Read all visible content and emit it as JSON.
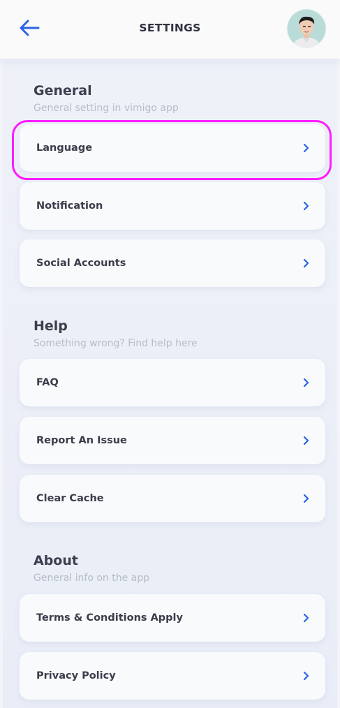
{
  "header": {
    "title": "SETTINGS",
    "accent_color": "#2a63e6"
  },
  "sections": [
    {
      "title": "General",
      "subtitle": "General setting in vimigo app",
      "items": [
        {
          "label": "Language",
          "icon": "chevron-right-icon"
        },
        {
          "label": "Notification",
          "icon": "chevron-right-icon"
        },
        {
          "label": "Social Accounts",
          "icon": "chevron-right-icon"
        }
      ]
    },
    {
      "title": "Help",
      "subtitle": "Something wrong? Find help here",
      "items": [
        {
          "label": "FAQ",
          "icon": "chevron-right-icon"
        },
        {
          "label": "Report An Issue",
          "icon": "chevron-right-icon"
        },
        {
          "label": "Clear Cache",
          "icon": "chevron-right-icon"
        }
      ]
    },
    {
      "title": "About",
      "subtitle": "General info on the app",
      "items": [
        {
          "label": "Terms & Conditions Apply",
          "icon": "chevron-right-icon"
        },
        {
          "label": "Privacy Policy",
          "icon": "chevron-right-icon"
        }
      ]
    }
  ],
  "highlight_color": "#ff1cff"
}
